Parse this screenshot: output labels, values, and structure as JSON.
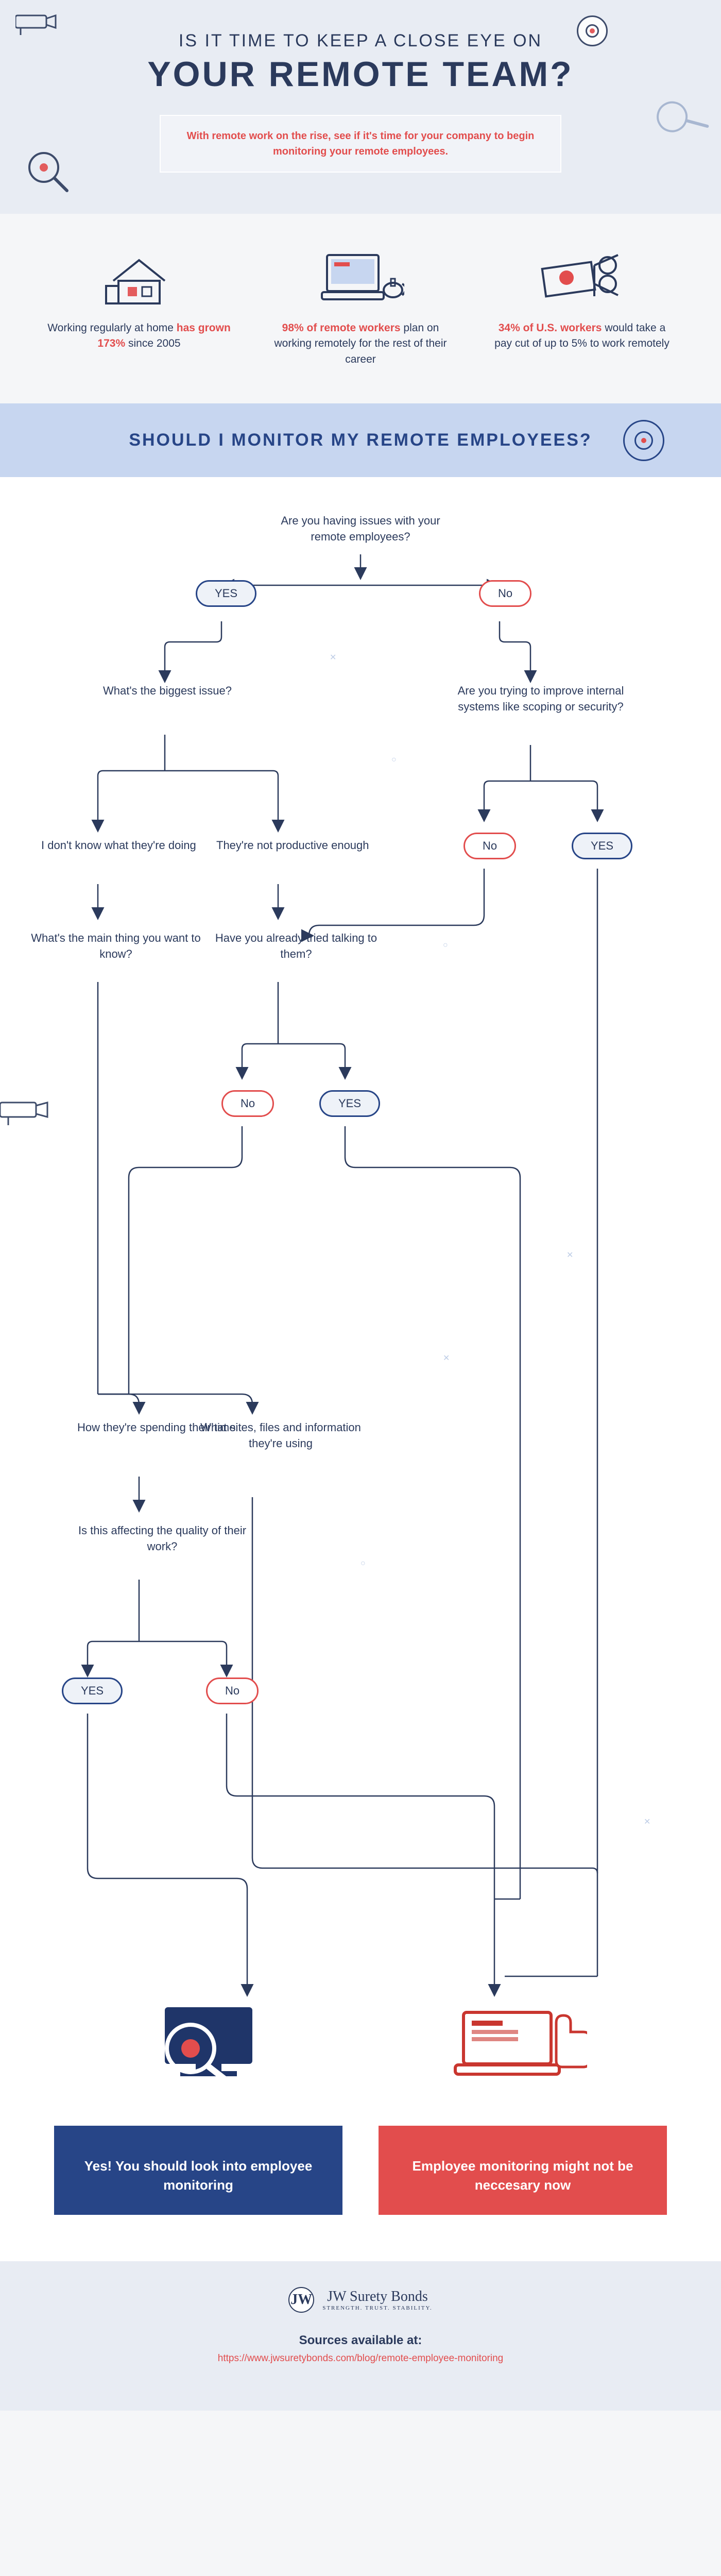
{
  "hero": {
    "line1": "IS IT TIME TO KEEP A CLOSE EYE ON",
    "line2": "YOUR REMOTE TEAM?",
    "sub": "With remote work on the rise, see if it's time for your company to begin monitoring your remote employees."
  },
  "stats": [
    {
      "pre": "Working regularly at home ",
      "hl": "has grown 173%",
      "post": " since 2005",
      "icon": "house-icon"
    },
    {
      "pre": "",
      "hl": "98% of remote workers",
      "post": " plan on working remotely for the rest of their career",
      "icon": "laptop-icon"
    },
    {
      "pre": "",
      "hl": "34% of U.S. workers",
      "post": " would take a pay cut of up to 5% to work remotely",
      "icon": "money-icon"
    }
  ],
  "sectionHeader": "SHOULD I MONITOR MY REMOTE EMPLOYEES?",
  "flow": {
    "q1": "Are you having issues with your remote employees?",
    "yes": "YES",
    "no": "No",
    "q_biggest": "What's the biggest issue?",
    "q_improve": "Are you trying to improve internal systems like scoping or security?",
    "a_dontknow": "I don't know what they're doing",
    "a_notprod": "They're not productive enough",
    "q_mainthing": "What's the main thing you want to know?",
    "q_talked": "Have you already tried talking to them?",
    "q_spending": "How they're spending their time",
    "q_sites": "What sites, files and information they're using",
    "q_quality": "Is this affecting the quality of their work?"
  },
  "results": {
    "yes": "Yes! You should look into employee monitoring",
    "no": "Employee monitoring might not be neccesary now"
  },
  "footer": {
    "brand": "JW Surety Bonds",
    "tagline": "STRENGTH. TRUST. STABILITY.",
    "sourcesLabel": "Sources available at:",
    "sourcesUrl": "https://www.jwsuretybonds.com/blog/remote-employee-monitoring"
  },
  "colors": {
    "blue": "#274587",
    "red": "#e24d4d",
    "ink": "#2b3a5c"
  }
}
